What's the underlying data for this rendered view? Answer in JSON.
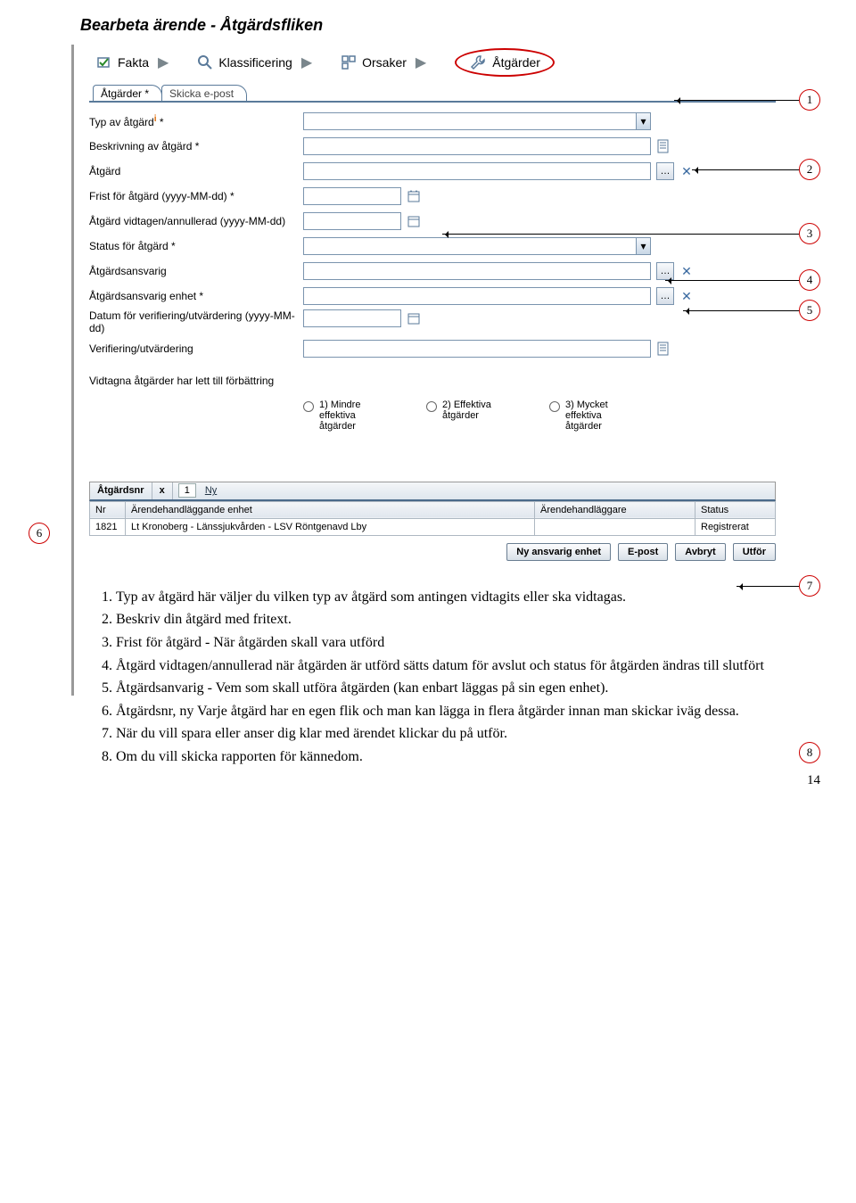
{
  "page_title": "Bearbeta ärende - Åtgärdsfliken",
  "top_tabs": {
    "fakta": "Fakta",
    "klassificering": "Klassificering",
    "orsaker": "Orsaker",
    "atgarder": "Åtgärder"
  },
  "sub_tabs": {
    "atgarder": "Åtgärder *",
    "skicka": "Skicka e-post"
  },
  "form": {
    "typ_av_atgard": "Typ av åtgärd",
    "typ_star": " *",
    "beskrivning": "Beskrivning av åtgärd *",
    "atgard": "Åtgärd",
    "frist": "Frist för åtgärd (yyyy-MM-dd) *",
    "vidtagen": "Åtgärd vidtagen/annullerad (yyyy-MM-dd)",
    "status": "Status för åtgärd *",
    "ansvarig": "Åtgärdsansvarig",
    "ansvarig_enhet": "Åtgärdsansvarig enhet *",
    "datum_verif": "Datum för verifiering/utvärdering (yyyy-MM-dd)",
    "verif": "Verifiering/utvärdering",
    "vidtagna": "Vidtagna åtgärder har lett till förbättring",
    "r1": "1) Mindre effektiva åtgärder",
    "r2": "2) Effektiva åtgärder",
    "r3": "3) Mycket effektiva åtgärder"
  },
  "atg_bar": {
    "label": "Åtgärdsnr",
    "x": "x",
    "num": "1",
    "ny": "Ny"
  },
  "table": {
    "headers": {
      "nr": "Nr",
      "enhet": "Ärendehandläggande enhet",
      "handlaggare": "Ärendehandläggare",
      "status": "Status"
    },
    "row": {
      "nr": "1821",
      "enhet": "Lt Kronoberg - Länssjukvården - LSV Röntgenavd Lby",
      "handlaggare": "",
      "status": "Registrerat"
    }
  },
  "buttons": {
    "ny": "Ny ansvarig enhet",
    "epost": "E-post",
    "avbryt": "Avbryt",
    "utfor": "Utför"
  },
  "callouts": {
    "c1": "1",
    "c2": "2",
    "c3": "3",
    "c4": "4",
    "c5": "5",
    "c6": "6",
    "c7": "7",
    "c8": "8"
  },
  "instructions": {
    "i1": "Typ av åtgärd här väljer du vilken typ av åtgärd som antingen vidtagits eller ska vidtagas.",
    "i2": "Beskriv din åtgärd med fritext.",
    "i3": "Frist för åtgärd - När åtgärden skall vara utförd",
    "i4": "Åtgärd vidtagen/annullerad när åtgärden är utförd sätts datum för avslut och status för åtgärden ändras till slutfört",
    "i5": "Åtgärdsanvarig - Vem som skall utföra åtgärden (kan enbart läggas på sin egen enhet).",
    "i6": "Åtgärdsnr, ny Varje åtgärd har en egen flik och man kan lägga in flera åtgärder innan man skickar iväg dessa.",
    "i7": "När du vill spara eller anser dig klar med ärendet klickar du på utför.",
    "i8": "Om du vill skicka rapporten för kännedom."
  },
  "page_number": "14"
}
